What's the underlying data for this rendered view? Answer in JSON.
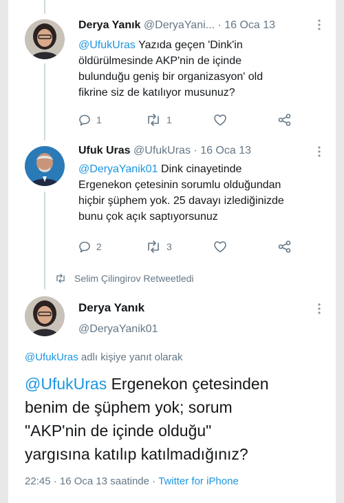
{
  "tweets": [
    {
      "display_name": "Derya Yanık",
      "handle": "@DeryaYani...",
      "separator": "·",
      "date": "16 Oca 13",
      "mention": "@UfukUras",
      "text_line1": " Yazıda geçen 'Dink'in",
      "text_rest": [
        "öldürülmesinde AKP'nin de içinde",
        "bulunduğu geniş bir organizasyon' old",
        "fikrine siz de katılıyor musunuz?"
      ],
      "reply_count": "1",
      "retweet_count": "1"
    },
    {
      "display_name": "Ufuk Uras",
      "handle": "@UfukUras",
      "separator": "·",
      "date": "16 Oca 13",
      "mention": "@DeryaYanik01",
      "text_line1": " Dink cinayetinde",
      "text_rest": [
        "Ergenekon çetesinin sorumlu olduğundan",
        "hiçbir şüphem yok. 25 davayı izlediğinizde",
        "bunu çok açık saptıyorsunuz"
      ],
      "reply_count": "2",
      "retweet_count": "3"
    }
  ],
  "retweet_note": "Selim Çilingirov Retweetledi",
  "main_tweet": {
    "display_name": "Derya Yanık",
    "handle": "@DeryaYanik01",
    "reply_mention": "@UfukUras",
    "reply_suffix": " adlı kişiye yanıt olarak",
    "mention": "@UfukUras",
    "text_line1": " Ergenekon çetesinden",
    "text_rest": [
      "benim de şüphem yok; sorum",
      "\"AKP'nin de içinde olduğu\"",
      "yargısına katılıp katılmadığınız?"
    ],
    "time": "22:45",
    "date_text": "16 Oca 13 saatinde",
    "separator": "·",
    "source": "Twitter for iPhone"
  },
  "colors": {
    "accent": "#1b95e0",
    "muted": "#657786",
    "line": "#cfd9de"
  },
  "icons": [
    "reply-icon",
    "retweet-icon",
    "like-icon",
    "share-icon",
    "more-icon"
  ]
}
